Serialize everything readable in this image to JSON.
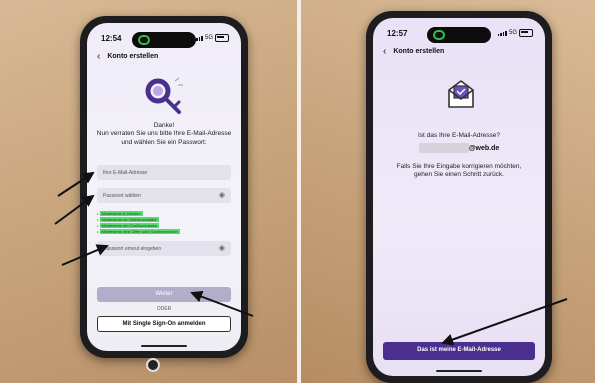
{
  "left_phone": {
    "status_time": "12:54",
    "status_network": "5G",
    "nav_title": "Konto erstellen",
    "intro_line1": "Danke!",
    "intro_line2": "Nun verraten Sie uns bitte Ihre E-Mail-Adresse",
    "intro_line3": "und wählen Sie ein Passwort:",
    "email_placeholder": "Ihre E-Mail-Adresse",
    "password_placeholder": "Passwort wählen",
    "password_hints": [
      "Mindestens 8 Zeichen",
      "Mindestens ein Kleinbuchstabe",
      "Mindestens ein Großbuchstabe",
      "Mindestens eine Ziffer oder Sonderzeichen"
    ],
    "password_repeat_placeholder": "Passwort erneut eingeben",
    "continue_label": "Weiter",
    "or_label": "ODER",
    "sso_label": "Mit Single Sign-On anmelden"
  },
  "right_phone": {
    "status_time": "12:57",
    "status_network": "5G",
    "nav_title": "Konto erstellen",
    "question": "Ist das Ihre E-Mail-Adresse?",
    "email_domain": "@web.de",
    "hint_line1": "Falls Sie Ihre Eingabe korrigieren möchten,",
    "hint_line2": "gehen Sie einen Schritt zurück.",
    "confirm_label": "Das ist meine E-Mail-Adresse"
  },
  "colors": {
    "accent_purple": "#4a2f8f",
    "hint_highlight": "#4fe06a",
    "button_disabled": "#b2aec9"
  }
}
